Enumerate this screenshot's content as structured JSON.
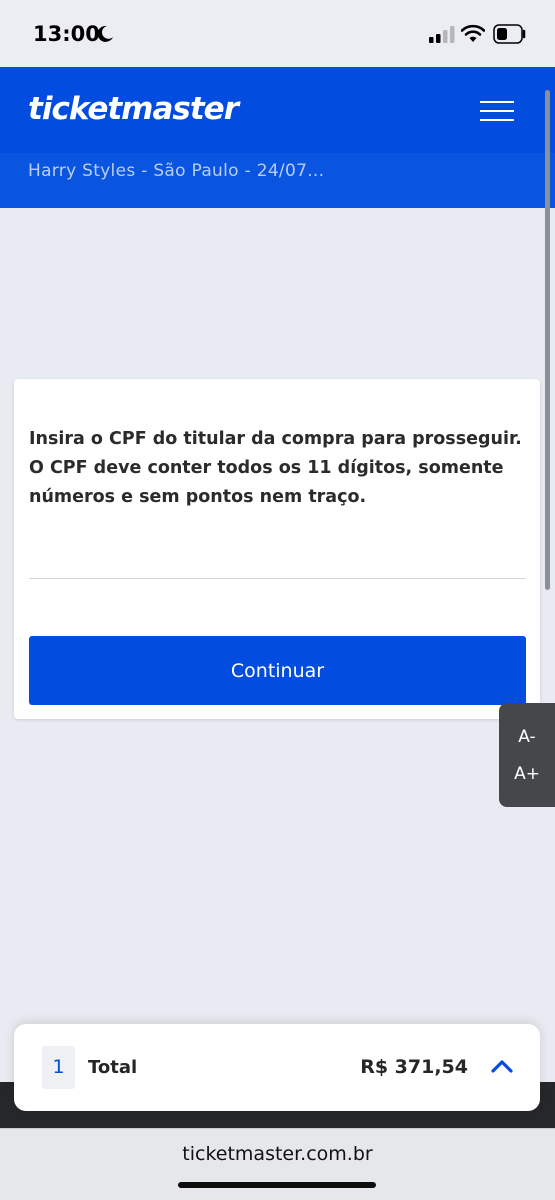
{
  "status_bar": {
    "time": "13:00",
    "icons": [
      "moon-icon",
      "signal-icon",
      "wifi-icon",
      "battery-icon"
    ]
  },
  "header": {
    "logo": "ticketmaster",
    "subtitle": "Harry Styles - São Paulo - 24/07...",
    "menu_icon": "hamburger-icon"
  },
  "card": {
    "instructions": "Insira o CPF do titular da compra para prosseguir. O CPF deve conter todos os 11 dígitos, somente números e sem pontos nem traço.",
    "cpf_value": "",
    "continue_label": "Continuar"
  },
  "font_controls": {
    "decrease_label": "A-",
    "increase_label": "A+"
  },
  "summary": {
    "quantity": "1",
    "total_label": "Total",
    "total_amount": "R$ 371,54",
    "expand_icon": "chevron-up-icon"
  },
  "browser": {
    "url": "ticketmaster.com.br"
  },
  "colors": {
    "brand_blue": "#024ddf",
    "background": "#e8ebf1",
    "text_dark": "#262626"
  }
}
